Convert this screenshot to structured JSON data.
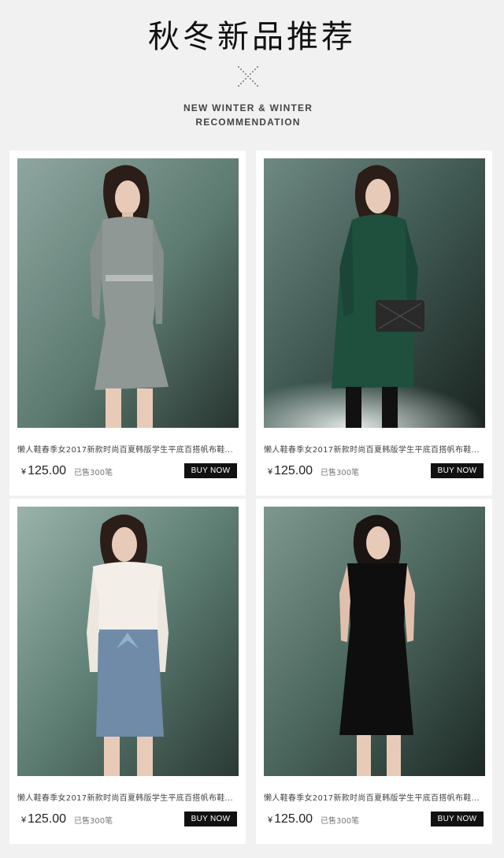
{
  "header": {
    "title": "秋冬新品推荐",
    "subtitle_line1": "NEW WINTER & WINTER",
    "subtitle_line2": "RECOMMENDATION"
  },
  "products": [
    {
      "image": "woman-in-grey-knit-dress",
      "description": "懒人鞋春季女2017新款时尚百夏韩版学生平底百搭帆布鞋...",
      "currency": "¥",
      "price": "125.00",
      "sold": "已售300笔",
      "button": "BUY NOW"
    },
    {
      "image": "woman-in-dark-green-sweater-dress",
      "description": "懒人鞋春季女2017新款时尚百夏韩版学生平底百搭帆布鞋...",
      "currency": "¥",
      "price": "125.00",
      "sold": "已售300笔",
      "button": "BUY NOW"
    },
    {
      "image": "woman-in-white-blouse-blue-skirt",
      "description": "懒人鞋春季女2017新款时尚百夏韩版学生平底百搭帆布鞋...",
      "currency": "¥",
      "price": "125.00",
      "sold": "已售300笔",
      "button": "BUY NOW"
    },
    {
      "image": "woman-in-black-sleeveless-dress",
      "description": "懒人鞋春季女2017新款时尚百夏韩版学生平底百搭帆布鞋...",
      "currency": "¥",
      "price": "125.00",
      "sold": "已售300笔",
      "button": "BUY NOW"
    }
  ]
}
